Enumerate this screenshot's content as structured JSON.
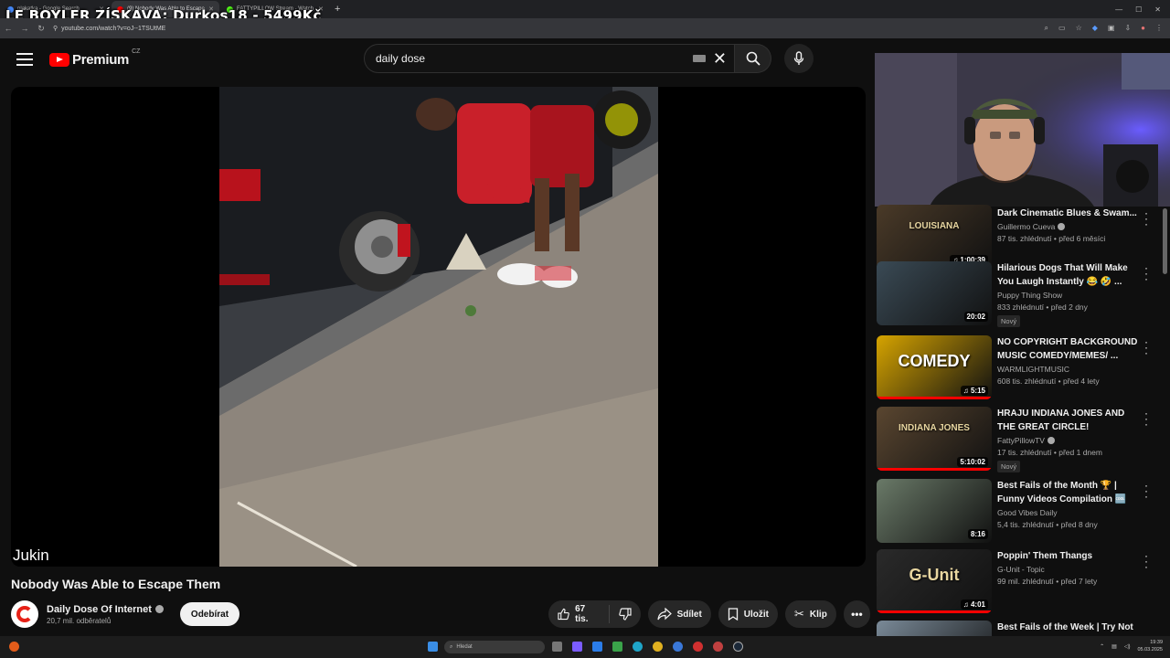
{
  "stream_overlay": {
    "text": "LE BOYLER ZÍSKAVA: Durkos18 - 5499Kč"
  },
  "browser": {
    "tabs": [
      {
        "label": "plakatka - Google Search",
        "color": "#4285f4",
        "active": false
      },
      {
        "label": "(9) Nobody Was Able to Escape",
        "color": "#ff0000",
        "active": true
      },
      {
        "label": "FATTYPILLOW Stream - Watch",
        "color": "#53fc18",
        "active": false
      }
    ],
    "url": "youtube.com/watch?v=oJ--1TSUtME"
  },
  "youtube": {
    "logo_text": "Premium",
    "region": "CZ",
    "search": {
      "query": "daily dose"
    }
  },
  "player": {
    "watermark": "Jukin"
  },
  "video": {
    "title": "Nobody Was Able to Escape Them",
    "channel": "Daily Dose Of Internet",
    "subscribers": "20,7 mil. odběratelů",
    "subscribe_label": "Odebírat",
    "likes": "67 tis.",
    "share_label": "Sdílet",
    "save_label": "Uložit",
    "clip_label": "Klip"
  },
  "recommendations": [
    {
      "title": "Dark Cinematic Blues & Swam...",
      "channel": "Guillermo Cueva",
      "verified": true,
      "meta": "87 tis. zhlédnutí • před 6 měsíci",
      "duration": "1:00:39",
      "badge": "",
      "music": true,
      "thumb_bg": "#4a3a28",
      "thumb_text": "LOUISIANA",
      "progress": 0
    },
    {
      "title": "Hilarious Dogs That Will Make You Laugh Instantly 😂 🤣 ...",
      "channel": "Puppy Thing Show",
      "verified": false,
      "meta": "833 zhlédnutí • před 2 dny",
      "duration": "20:02",
      "badge": "Nový",
      "music": false,
      "thumb_bg": "#3a4a55",
      "thumb_text": "",
      "progress": 0
    },
    {
      "title": "NO COPYRIGHT BACKGROUND MUSIC COMEDY/MEMES/ ...",
      "channel": "WARMLIGHTMUSIC",
      "verified": false,
      "meta": "608 tis. zhlédnutí • před 4 lety",
      "duration": "5:15",
      "badge": "",
      "music": true,
      "thumb_bg": "#d6a400",
      "thumb_text": "COMEDY",
      "progress": 1
    },
    {
      "title": "HRAJU INDIANA JONES AND THE GREAT CIRCLE!",
      "channel": "FattyPillowTV",
      "verified": true,
      "meta": "17 tis. zhlédnutí • před 1 dnem",
      "duration": "5:10:02",
      "badge": "Nový",
      "music": false,
      "thumb_bg": "#5a4630",
      "thumb_text": "INDIANA JONES",
      "progress": 1
    },
    {
      "title": "Best Fails of the Month 🏆 | Funny Videos Compilation 🆒",
      "channel": "Good Vibes Daily",
      "verified": false,
      "meta": "5,4 tis. zhlédnutí • před 8 dny",
      "duration": "8:16",
      "badge": "",
      "music": false,
      "thumb_bg": "#6a7a68",
      "thumb_text": "",
      "progress": 0
    },
    {
      "title": "Poppin' Them Thangs",
      "channel": "G-Unit - Topic",
      "verified": false,
      "meta": "99 mil. zhlédnutí • před 7 lety",
      "duration": "4:01",
      "badge": "",
      "music": true,
      "thumb_bg": "#2a2a2a",
      "thumb_text": "G-Unit",
      "progress": 1
    },
    {
      "title": "Best Fails of the Week | Try Not",
      "channel": "",
      "verified": false,
      "meta": "",
      "duration": "",
      "badge": "",
      "music": false,
      "thumb_bg": "#7a8a98",
      "thumb_text": "",
      "progress": 0
    }
  ],
  "taskbar": {
    "search_placeholder": "Hledat",
    "time": "19:39",
    "date": "05.03.2025"
  },
  "colors": {
    "accent": "#ff0000",
    "background": "#0f0f0f",
    "pill": "#272727"
  }
}
